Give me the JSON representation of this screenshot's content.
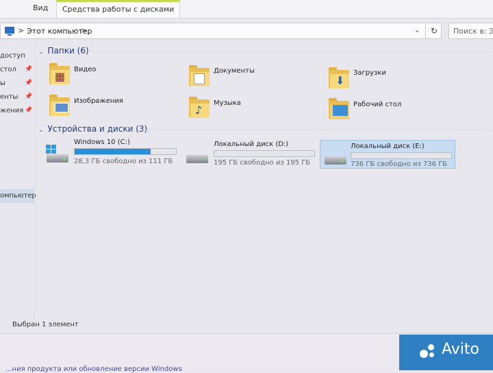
{
  "ribbon": {
    "tab_view": "Вид",
    "tab_drive_tools": "Средства работы с дисками"
  },
  "address": {
    "sep": ">",
    "path": "Этот компьютер",
    "sep2": ">",
    "dropdown": "⌄",
    "refresh": "↻"
  },
  "search": {
    "placeholder": "Поиск в: Этот"
  },
  "nav": {
    "items": [
      "доступ",
      "стол",
      "ы",
      "енты",
      "жения",
      "омпьютер"
    ],
    "pin": "📌"
  },
  "folders_section": {
    "title": "Папки (6)",
    "chev": "⌄"
  },
  "folders": [
    {
      "label": "Видео",
      "icon": "video-folder-icon"
    },
    {
      "label": "Документы",
      "icon": "documents-folder-icon"
    },
    {
      "label": "Загрузки",
      "icon": "downloads-folder-icon"
    },
    {
      "label": "Изображения",
      "icon": "pictures-folder-icon"
    },
    {
      "label": "Музыка",
      "icon": "music-folder-icon"
    },
    {
      "label": "Рабочий стол",
      "icon": "desktop-folder-icon"
    }
  ],
  "drives_section": {
    "title": "Устройства и диски (3)",
    "chev": "⌄"
  },
  "drives": [
    {
      "label": "Windows 10 (C:)",
      "info": "28,3 ГБ свободно из 111 ГБ",
      "used_fraction": 0.75,
      "icon": "windows-drive-icon"
    },
    {
      "label": "Локальный диск (D:)",
      "info": "195 ГБ свободно из 195 ГБ",
      "used_fraction": 0.0,
      "icon": "hard-drive-icon"
    },
    {
      "label": "Локальный диск (E:)",
      "info": "736 ГБ свободно из 736 ГБ",
      "used_fraction": 0.0,
      "icon": "hard-drive-icon",
      "selected": true
    }
  ],
  "status": {
    "text": "Выбран 1 элемент"
  },
  "bottom": {
    "text": "...ния продукта или обновление версии Windows"
  },
  "watermark": {
    "text": "Avito"
  },
  "colors": {
    "bar_fill": "#2b8fd8",
    "selection": "#c9ddf2",
    "folder": "#f7d97c"
  }
}
